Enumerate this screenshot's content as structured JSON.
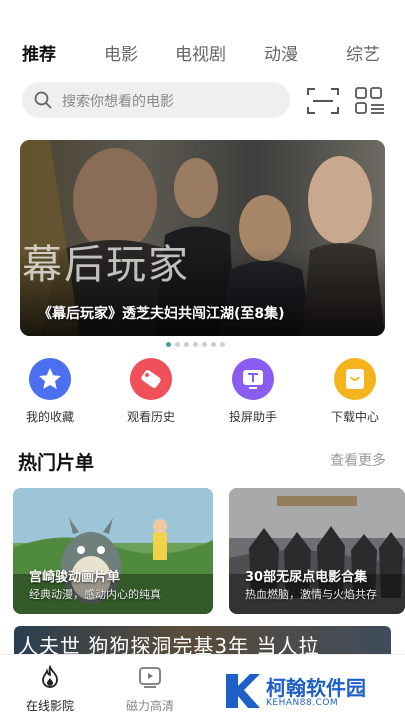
{
  "tabs": [
    {
      "label": "推荐",
      "active": true
    },
    {
      "label": "电影",
      "active": false
    },
    {
      "label": "电视剧",
      "active": false
    },
    {
      "label": "动漫",
      "active": false
    },
    {
      "label": "综艺",
      "active": false
    }
  ],
  "search": {
    "placeholder": "搜索你想看的电影",
    "icon": "search-icon"
  },
  "toolbar": {
    "scan_icon": "scan-icon",
    "menu_icon": "grid-menu-icon"
  },
  "banner": {
    "overlay_text": "幕后玩家",
    "caption": "《幕后玩家》透芝夫妇共闯江湖(至8集)",
    "dots": 7,
    "active_dot": 0
  },
  "quick_actions": [
    {
      "label": "我的收藏",
      "icon": "star-icon",
      "color": "#4a6ff0"
    },
    {
      "label": "观看历史",
      "icon": "history-tag-icon",
      "color": "#f0505a"
    },
    {
      "label": "投屏助手",
      "icon": "tv-cast-icon",
      "color": "#8a5cf0"
    },
    {
      "label": "下载中心",
      "icon": "download-box-icon",
      "color": "#f5b41e"
    }
  ],
  "hot_section": {
    "title": "热门片单",
    "more": "查看更多"
  },
  "cards": [
    {
      "title": "宫崎骏动画片单",
      "subtitle": "经典动漫，感动内心的纯真"
    },
    {
      "title": "30部无尿点电影合集",
      "subtitle": "热血燃脑，激情与火焰共存"
    }
  ],
  "strip_text": "人夫世  狗狗探洞完基3年  当人拉",
  "bottom_nav": [
    {
      "label": "在线影院",
      "icon": "flame-icon",
      "active": true
    },
    {
      "label": "磁力高清",
      "icon": "play-box-icon",
      "active": false
    }
  ],
  "watermark": {
    "title": "柯翰软件园",
    "sub": "KEHAN88.COM"
  },
  "colors": {
    "accent": "#3aa0a8",
    "brand_blue": "#1e5fc8"
  }
}
